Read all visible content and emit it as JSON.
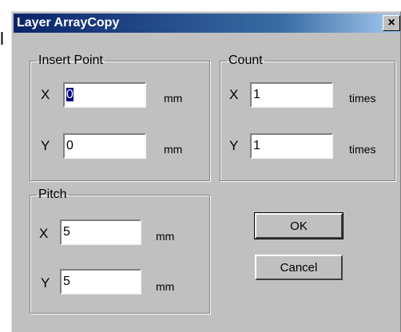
{
  "background_text": "l",
  "dialog": {
    "title": "Layer ArrayCopy",
    "close_label": "×"
  },
  "insert_point": {
    "legend": "Insert Point",
    "x_label": "X",
    "x_value": "0",
    "x_unit": "mm",
    "y_label": "Y",
    "y_value": "0",
    "y_unit": "mm"
  },
  "count": {
    "legend": "Count",
    "x_label": "X",
    "x_value": "1",
    "x_unit": "times",
    "y_label": "Y",
    "y_value": "1",
    "y_unit": "times"
  },
  "pitch": {
    "legend": "Pitch",
    "x_label": "X",
    "x_value": "5",
    "x_unit": "mm",
    "y_label": "Y",
    "y_value": "5",
    "y_unit": "mm"
  },
  "buttons": {
    "ok_label": "OK",
    "cancel_label": "Cancel"
  }
}
